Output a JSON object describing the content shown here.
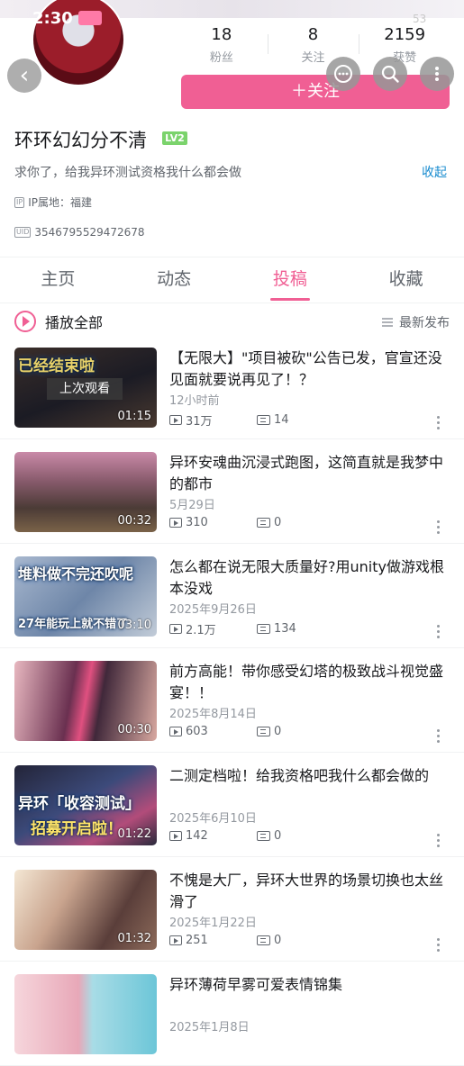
{
  "status": {
    "time": "2:30",
    "badge": "53"
  },
  "profile": {
    "stats": [
      {
        "num": "18",
        "label": "粉丝"
      },
      {
        "num": "8",
        "label": "关注"
      },
      {
        "num": "2159",
        "label": "获赞"
      }
    ],
    "follow_label": "＋关注",
    "username": "环环幻幻分不清",
    "level": "LV2",
    "signature": "求你了，给我异环测试资格我什么都会做",
    "collapse_label": "收起",
    "ip_tag": "IP",
    "ip_text": "IP属地：福建",
    "uid_tag": "UID",
    "uid": "3546795529472678"
  },
  "tabs": [
    "主页",
    "动态",
    "投稿",
    "收藏"
  ],
  "active_tab": "投稿",
  "toolbar": {
    "play_all": "播放全部",
    "sort": "最新发布"
  },
  "videos": [
    {
      "title": "【无限大】\"项目被砍\"公告已发，官宣还没见面就要说再见了！？",
      "date": "12小时前",
      "views": "31万",
      "danmaku": "14",
      "duration": "01:15",
      "thumb_text": "已经结束啦",
      "resume": "上次观看",
      "thumb_sub": ""
    },
    {
      "title": "异环安魂曲沉浸式跑图，这简直就是我梦中的都市",
      "date": "5月29日",
      "views": "310",
      "danmaku": "0",
      "duration": "00:32",
      "thumb_text": "",
      "resume": "",
      "thumb_sub": ""
    },
    {
      "title": "怎么都在说无限大质量好?用unity做游戏根本没戏",
      "date": "2025年9月26日",
      "views": "2.1万",
      "danmaku": "134",
      "duration": "03:10",
      "thumb_text": "堆料做不完还吹呢",
      "resume": "",
      "thumb_sub": "27年能玩上就不错了"
    },
    {
      "title": "前方高能！带你感受幻塔的极致战斗视觉盛宴！！",
      "date": "2025年8月14日",
      "views": "603",
      "danmaku": "0",
      "duration": "00:30",
      "thumb_text": "",
      "resume": "",
      "thumb_sub": ""
    },
    {
      "title": "二测定档啦！给我资格吧我什么都会做的",
      "date": "2025年6月10日",
      "views": "142",
      "danmaku": "0",
      "duration": "01:22",
      "thumb_text": "异环「收容测试」",
      "resume": "",
      "thumb_sub": "招募开启啦！"
    },
    {
      "title": "不愧是大厂，异环大世界的场景切换也太丝滑了",
      "date": "2025年1月22日",
      "views": "251",
      "danmaku": "0",
      "duration": "01:32",
      "thumb_text": "",
      "resume": "",
      "thumb_sub": ""
    },
    {
      "title": "异环薄荷早雾可爱表情锦集",
      "date": "2025年1月8日",
      "views": "",
      "danmaku": "",
      "duration": "",
      "thumb_text": "",
      "resume": "",
      "thumb_sub": ""
    }
  ],
  "colors": {
    "accent": "#f05f94",
    "link": "#178bcf",
    "level": "#7bd36c"
  }
}
